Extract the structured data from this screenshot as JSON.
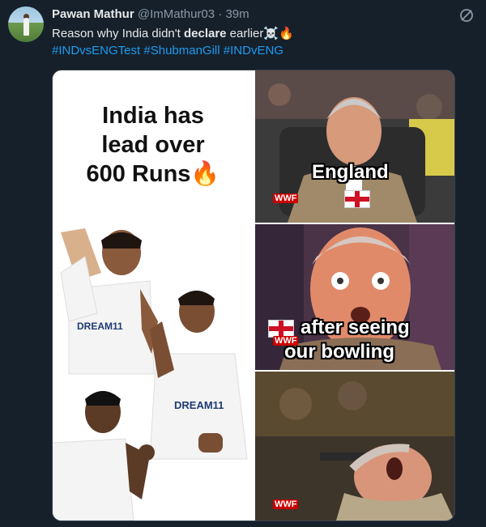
{
  "tweet": {
    "author_name": "Pawan Mathur",
    "handle": "@ImMathur03",
    "separator": "·",
    "time": "39m",
    "text_before": "Reason why India didn't ",
    "text_bold": "declare",
    "text_after": " earlier☠️🔥",
    "hashtags": [
      "#INDvsENGTest",
      "#ShubmanGill",
      "#INDvENG"
    ]
  },
  "meme": {
    "caption_top_left": "India has lead over 600 Runs🔥",
    "caption_line1": "India has",
    "caption_line2": "lead over",
    "caption_line3": "600 Runs🔥",
    "label_england": "England",
    "label_after_line1": "after seeing",
    "label_after_line2": "our bowling",
    "jersey_text": "DREAM11",
    "logo_text": "WWF"
  },
  "colors": {
    "background": "#15202b",
    "link": "#1d9bf0",
    "muted": "#8b98a5",
    "text": "#e7e9ea"
  },
  "icons": {
    "more": "grok-slash-icon"
  }
}
